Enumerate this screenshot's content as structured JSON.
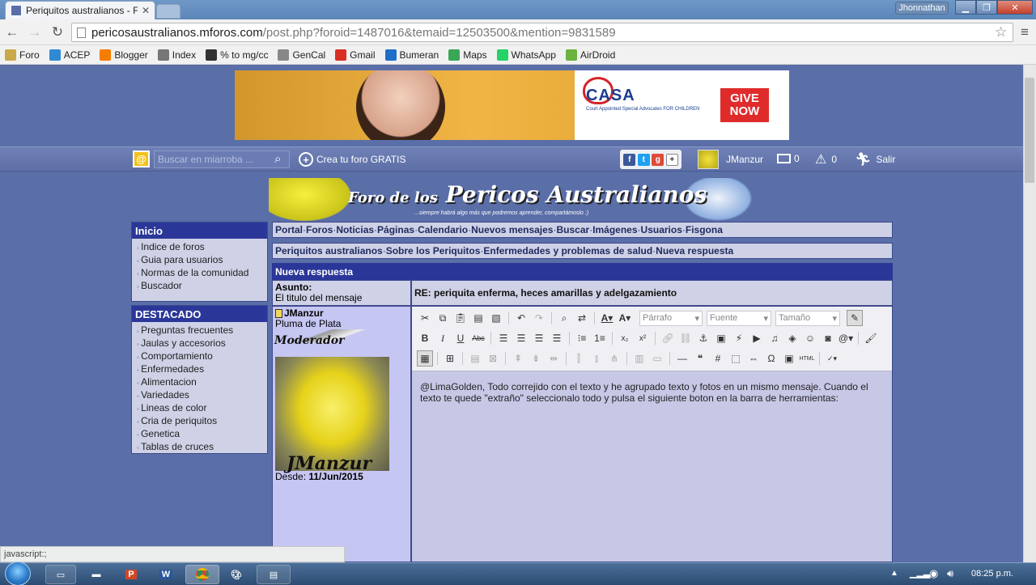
{
  "browser": {
    "tab_title": "Periquitos australianos - F",
    "user_name": "Jhonnathan",
    "url_host": "pericosaustralianos.mforos.com",
    "url_path": "/post.php?foroid=1487016&temaid=12503500&mention=9831589",
    "bookmarks": [
      {
        "label": "Foro",
        "icon": "folder-icon",
        "color": "#c9a94a"
      },
      {
        "label": "ACEP",
        "icon": "chat-icon",
        "color": "#2f8ad6"
      },
      {
        "label": "Blogger",
        "icon": "blogger-icon",
        "color": "#f57d00"
      },
      {
        "label": "Index",
        "icon": "fingerprint-icon",
        "color": "#777777"
      },
      {
        "label": "% to mg/cc",
        "icon": "m-icon",
        "color": "#333333"
      },
      {
        "label": "GenCal",
        "icon": "page-icon",
        "color": "#888888"
      },
      {
        "label": "Gmail",
        "icon": "gmail-icon",
        "color": "#d93025"
      },
      {
        "label": "Bumeran",
        "icon": "bumeran-icon",
        "color": "#1e6fc8"
      },
      {
        "label": "Maps",
        "icon": "maps-icon",
        "color": "#3aa757"
      },
      {
        "label": "WhatsApp",
        "icon": "whatsapp-icon",
        "color": "#25d366"
      },
      {
        "label": "AirDroid",
        "icon": "airdroid-icon",
        "color": "#6cb33f"
      }
    ],
    "status_text": "javascript:;"
  },
  "ad": {
    "brand": "CASA",
    "brand_sub": "Court Appointed Special Advocates FOR CHILDREN",
    "cta_line1": "GIVE",
    "cta_line2": "NOW"
  },
  "mbar": {
    "search_placeholder": "Buscar en miarroba ...",
    "create_label": "Crea tu foro GRATIS",
    "username": "JManzur",
    "messages_count": "0",
    "alerts_count": "0",
    "logout_label": "Salir"
  },
  "banner": {
    "title_a": "Foro de los",
    "title_b": "Pericos Australianos",
    "subtitle": "...siempre habrá algo más que podremos aprender, compartámoslo :)"
  },
  "sidebar": {
    "inicio_title": "Inicio",
    "inicio_items": [
      "Indice de foros",
      "Guia para usuarios",
      "Normas de la comunidad",
      "Buscador"
    ],
    "destacado_title": "DESTACADO",
    "destacado_items": [
      "Preguntas frecuentes",
      "Jaulas y accesorios",
      "Comportamiento",
      "Enfermedades",
      "Alimentacion",
      "Variedades",
      "Lineas de color",
      "Cria de periquitos",
      "Genetica",
      "Tablas de cruces"
    ]
  },
  "nav": {
    "items": [
      "Portal",
      "Foros",
      "Noticias",
      "Páginas",
      "Calendario",
      "Nuevos mensajes",
      "Buscar",
      "Imágenes",
      "Usuarios",
      "Fisgona"
    ]
  },
  "breadcrumb": {
    "items": [
      "Periquitos australianos",
      "Sobre los Periquitos",
      "Enfermedades y problemas de salud",
      "Nueva respuesta"
    ]
  },
  "post": {
    "header": "Nueva respuesta",
    "subject_label": "Asunto:",
    "subject_hint": "El titulo del mensaje",
    "subject_value": "RE: periquita enferma, heces amarillas y adelgazamiento",
    "author": "JManzur",
    "rank": "Pluma de Plata",
    "badge": "Moderador",
    "avatar_caption": "JManzur",
    "since_label": "Desde:",
    "since_value": "11/Jun/2015",
    "body": "@LimaGolden, Todo correjido con el texto y he agrupado texto y fotos en un mismo mensaje. Cuando el texto te quede \"extraño\" seleccionalo todo y pulsa el siguiente boton en la barra de herramientas:"
  },
  "editor": {
    "format_value": "Párrafo",
    "font_value": "Fuente",
    "size_value": "Tamaño"
  },
  "taskbar": {
    "clock": "08:25 p.m."
  }
}
